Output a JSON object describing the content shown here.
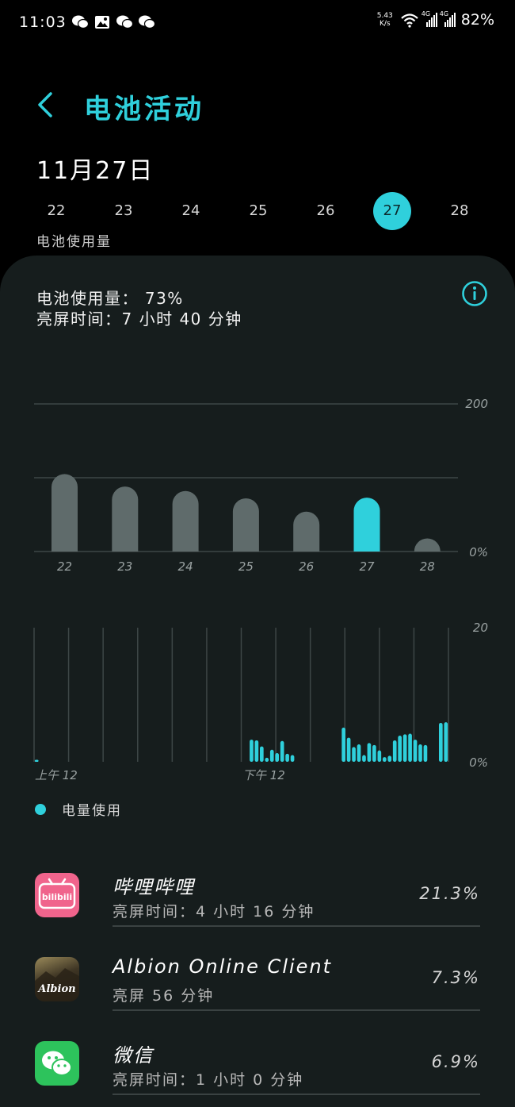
{
  "status": {
    "time": "11:03",
    "net_speed_value": "5.43",
    "net_speed_unit": "K/s",
    "sim1": "4G",
    "sim2": "4G",
    "battery": "82%"
  },
  "header": {
    "title": "电池活动",
    "back_icon": "chevron-left-icon"
  },
  "date_title": "11月27日",
  "days": [
    "22",
    "23",
    "24",
    "25",
    "26",
    "27",
    "28"
  ],
  "selected_day": "27",
  "usage_caption": "电池使用量",
  "summary": {
    "usage": "电池使用量： 73%",
    "screen_time": "亮屏时间：7 小时 40 分钟",
    "info_icon": "info-icon"
  },
  "colors": {
    "accent": "#2fd0dc",
    "bar_gray": "#5f6b6b",
    "panel_bg": "#161d1d"
  },
  "chart_data": [
    {
      "type": "bar",
      "categories": [
        "22",
        "23",
        "24",
        "25",
        "26",
        "27",
        "28"
      ],
      "values": [
        105,
        88,
        82,
        72,
        54,
        73,
        17
      ],
      "ylim": [
        0,
        200
      ],
      "y_ticks": [
        "200",
        "0%"
      ],
      "highlight_category": "27",
      "grid": true
    },
    {
      "type": "bar",
      "values": [
        0.3,
        0,
        0,
        0,
        0,
        0,
        0,
        0,
        0,
        0,
        0,
        0,
        0,
        0,
        0,
        0,
        0,
        0,
        0,
        0,
        0,
        0,
        0,
        0,
        0,
        0,
        0,
        0,
        0,
        0,
        0,
        0,
        0,
        0,
        0,
        0,
        0,
        0,
        0,
        0,
        0,
        0,
        3.3,
        3.2,
        2.3,
        0.6,
        1.8,
        1.3,
        3.1,
        1.2,
        1.0,
        0,
        0,
        0,
        0,
        0,
        0,
        0,
        0,
        0,
        5.1,
        3.6,
        2.2,
        2.6,
        1.0,
        2.8,
        2.5,
        1.7,
        0.7,
        0.9,
        3.2,
        3.9,
        4.1,
        4.2,
        3.3,
        2.6,
        2.5,
        0,
        0,
        5.8,
        5.9
      ],
      "ylim": [
        0,
        20
      ],
      "y_ticks": [
        "20",
        "0%"
      ],
      "x_ticks": [
        "上午 12",
        "下午 12"
      ],
      "grid": true
    }
  ],
  "legend": {
    "label": "电量使用"
  },
  "apps": [
    {
      "name": "哔哩哔哩",
      "sub": "亮屏时间：4 小时 16 分钟",
      "pct": "21.3%",
      "icon": "bilibili-icon",
      "icon_text": "bilibili"
    },
    {
      "name": "Albion Online Client",
      "sub": "亮屏 56 分钟",
      "pct": "7.3%",
      "icon": "albion-icon",
      "icon_text": "Albion"
    },
    {
      "name": "微信",
      "sub": "亮屏时间：1 小时 0 分钟",
      "pct": "6.9%",
      "icon": "wechat-icon"
    }
  ]
}
